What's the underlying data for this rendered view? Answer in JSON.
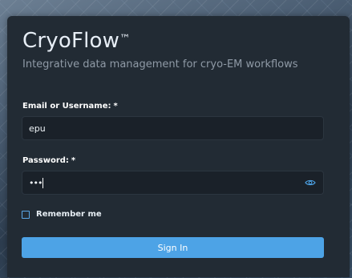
{
  "brand": {
    "name": "CryoFlow",
    "trademark": "™",
    "tagline": "Integrative data management for cryo-EM workflows"
  },
  "form": {
    "username": {
      "label": "Email or Username:",
      "required_mark": "*",
      "value": "epu"
    },
    "password": {
      "label": "Password:",
      "required_mark": "*",
      "value_masked": "•••"
    },
    "remember_label": "Remember me",
    "sign_in_label": "Sign In"
  },
  "colors": {
    "accent": "#4da3e6",
    "card": "#222b34",
    "input": "#1a2129"
  },
  "icons": {
    "password_toggle": "eye-icon"
  }
}
